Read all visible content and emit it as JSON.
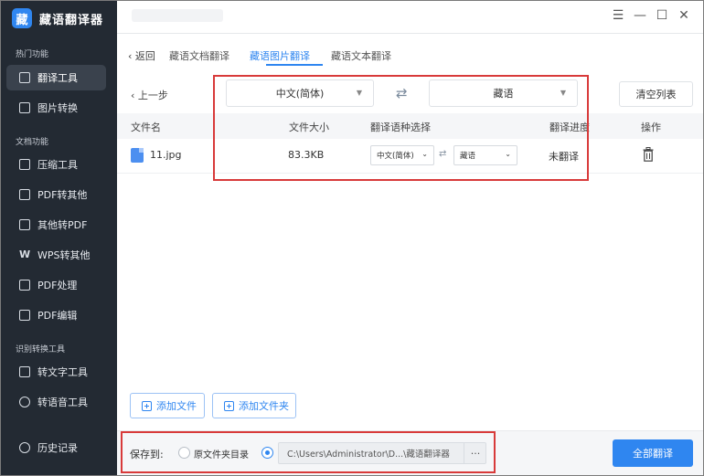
{
  "app": {
    "title": "藏语翻译器",
    "logo_char": "藏"
  },
  "sidebar": {
    "sections": [
      {
        "title": "热门功能"
      },
      {
        "title": "文档功能"
      },
      {
        "title": "识别转换工具"
      }
    ],
    "items": [
      {
        "label": "翻译工具",
        "icon": "translate-icon",
        "active": true
      },
      {
        "label": "图片转换",
        "icon": "image-convert-icon"
      },
      {
        "label": "压缩工具",
        "icon": "compress-icon"
      },
      {
        "label": "PDF转其他",
        "icon": "pdf-icon"
      },
      {
        "label": "其他转PDF",
        "icon": "pdf-icon"
      },
      {
        "label": "WPS转其他",
        "icon": "wps-icon"
      },
      {
        "label": "PDF处理",
        "icon": "pdf-process-icon"
      },
      {
        "label": "PDF编辑",
        "icon": "pdf-edit-icon"
      },
      {
        "label": "转文字工具",
        "icon": "text-tool-icon"
      },
      {
        "label": "转语音工具",
        "icon": "voice-tool-icon"
      },
      {
        "label": "历史记录",
        "icon": "history-icon"
      }
    ]
  },
  "window": {
    "menu": "☰",
    "minimize": "—",
    "maximize": "☐",
    "close": "✕"
  },
  "tabs": {
    "back_label": "返回",
    "items": [
      {
        "label": "藏语文档翻译"
      },
      {
        "label": "藏语图片翻译",
        "active": true
      },
      {
        "label": "藏语文本翻译"
      }
    ]
  },
  "toolbar": {
    "prev_label": "上一步",
    "source_lang": "中文(简体)",
    "target_lang": "藏语",
    "swap_symbol": "⇄",
    "clear_label": "清空列表"
  },
  "table": {
    "headers": {
      "name": "文件名",
      "size": "文件大小",
      "lang": "翻译语种选择",
      "progress": "翻译进度",
      "ops": "操作"
    },
    "rows": [
      {
        "name": "11.jpg",
        "size": "83.3KB",
        "source_lang": "中文(简体)",
        "target_lang": "藏语",
        "swap_symbol": "⇄",
        "progress": "未翻译"
      }
    ]
  },
  "actions": {
    "add_file": "添加文件",
    "add_folder": "添加文件夹"
  },
  "bottom": {
    "save_label": "保存到:",
    "option_original": "原文件夹目录",
    "path": "C:\\Users\\Administrator\\D...\\藏语翻译器",
    "browse": "···",
    "translate_all": "全部翻译"
  },
  "colors": {
    "accent": "#2f86f0",
    "sidebar_bg": "#232a33",
    "highlight": "#d83a3a"
  }
}
